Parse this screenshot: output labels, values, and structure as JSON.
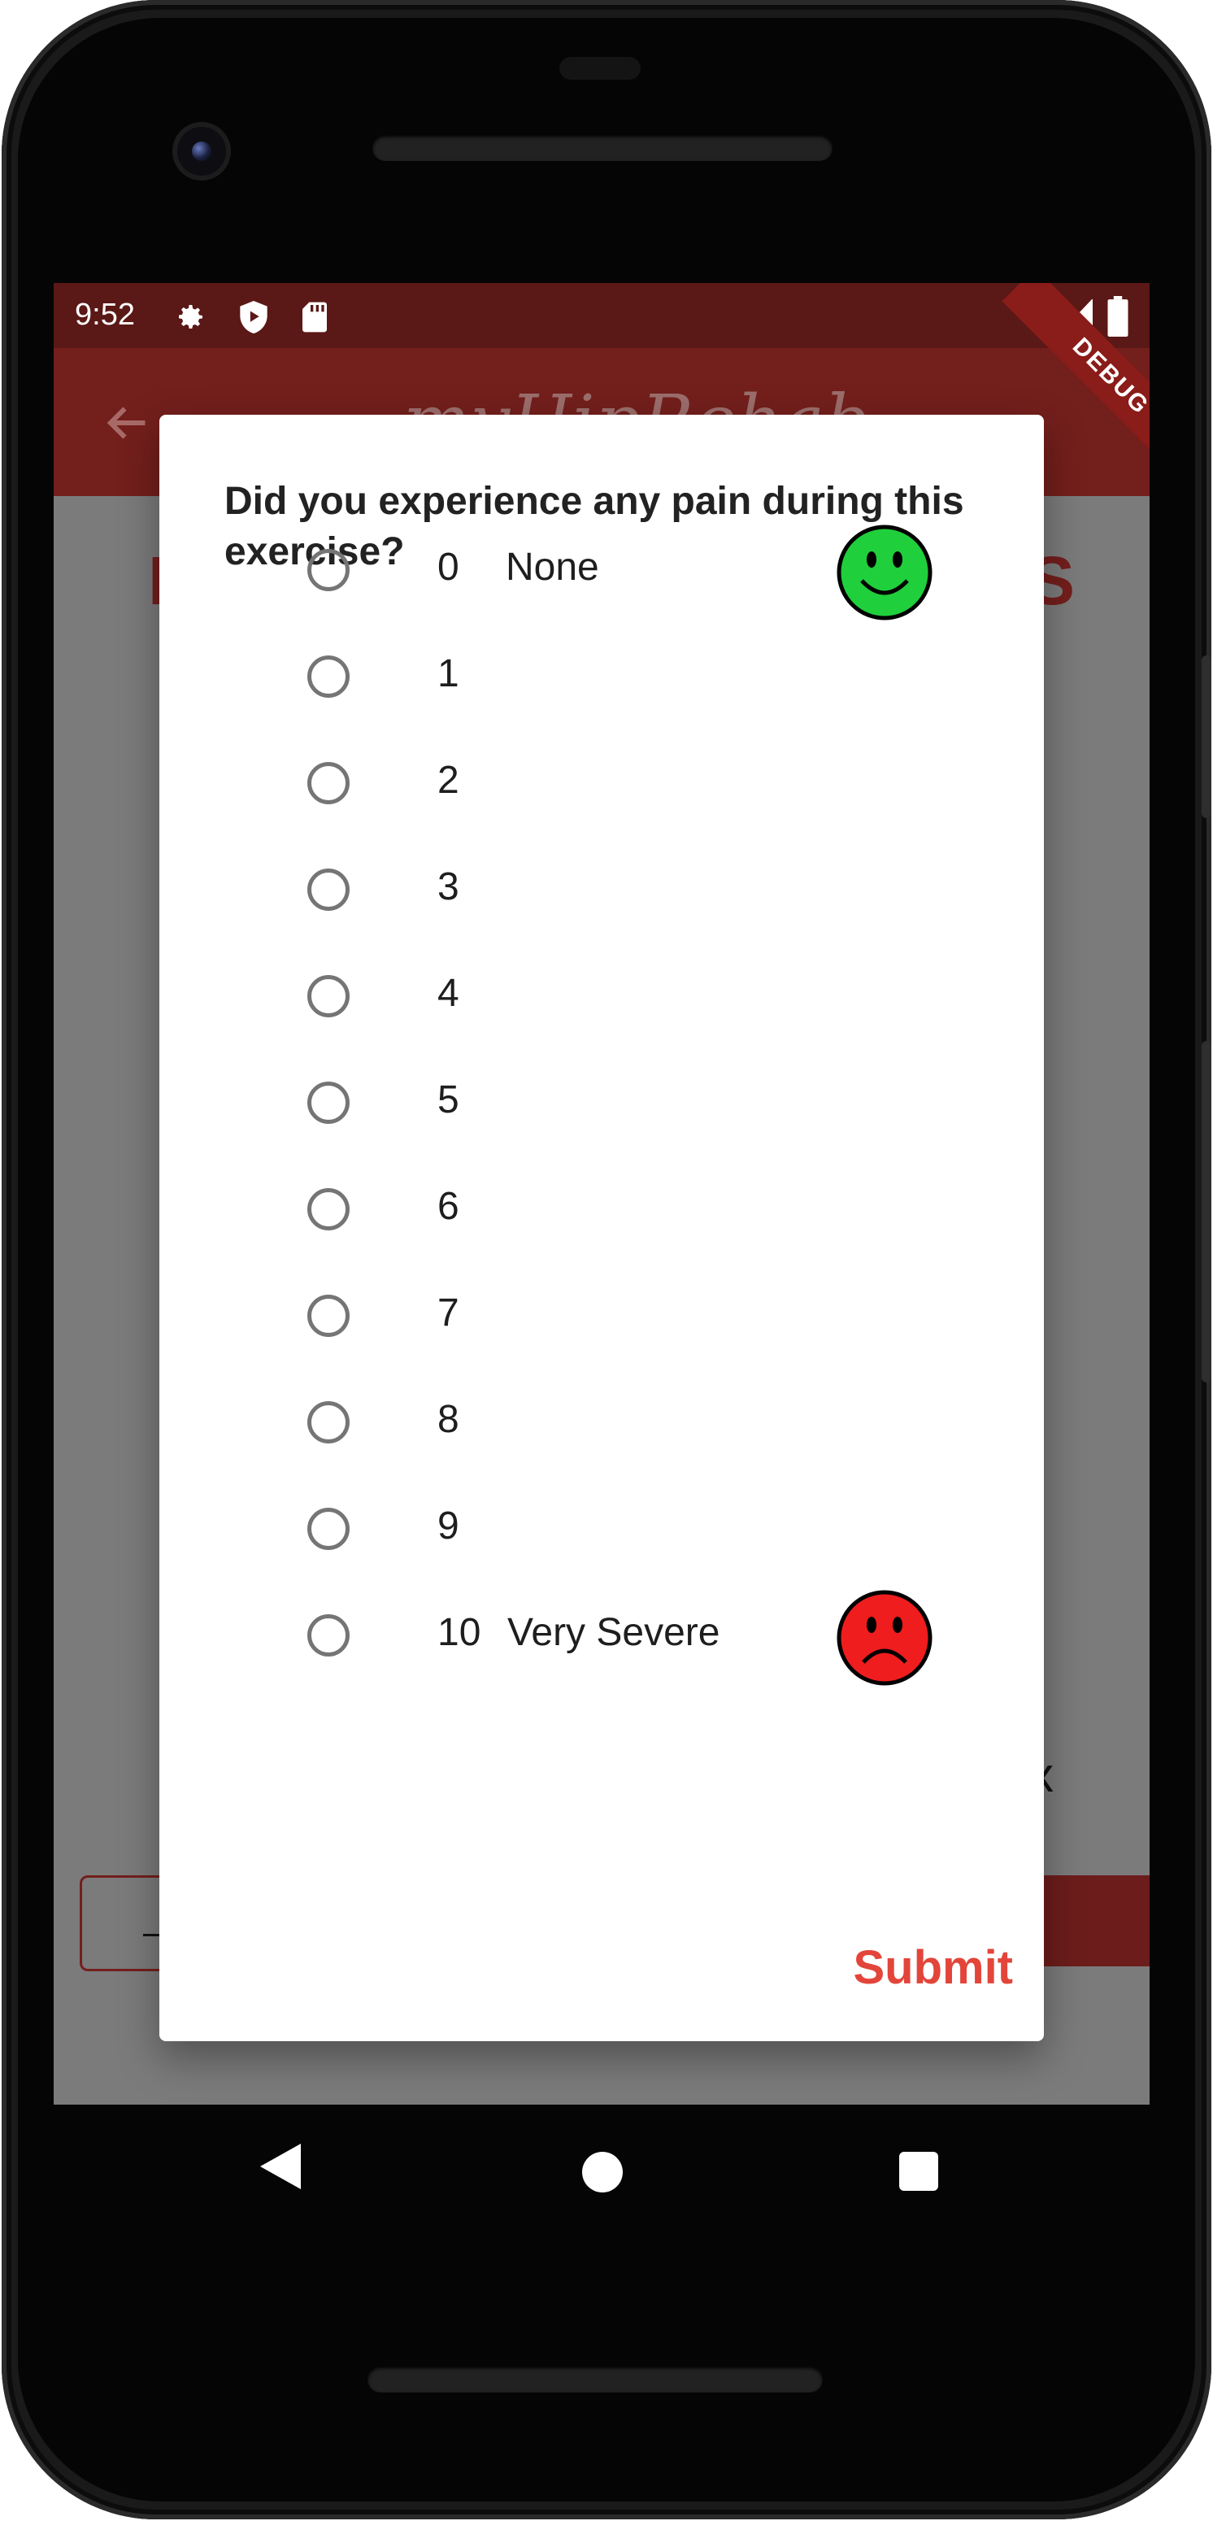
{
  "status_bar": {
    "time": "9:52",
    "left_icons": [
      "settings-gear-icon",
      "shield-play-icon",
      "sd-card-icon"
    ],
    "right_icons": [
      "wifi-icon",
      "signal-icon",
      "battery-icon"
    ],
    "debug_label": "DEBUG"
  },
  "app_bar": {
    "back_icon": "arrow-left-icon",
    "title": "myHipRehab"
  },
  "dialog": {
    "title": "Did you experience any pain during this exercise?",
    "options": [
      {
        "value": "0",
        "label": "None",
        "face": "happy-face-icon",
        "face_color": "#1fcf3b"
      },
      {
        "value": "1",
        "label": ""
      },
      {
        "value": "2",
        "label": ""
      },
      {
        "value": "3",
        "label": ""
      },
      {
        "value": "4",
        "label": ""
      },
      {
        "value": "5",
        "label": ""
      },
      {
        "value": "6",
        "label": ""
      },
      {
        "value": "7",
        "label": ""
      },
      {
        "value": "8",
        "label": ""
      },
      {
        "value": "9",
        "label": ""
      },
      {
        "value": "10",
        "label": "Very Severe",
        "face": "sad-face-icon",
        "face_color": "#ef1d1d"
      }
    ],
    "selected": null,
    "submit_label": "Submit"
  },
  "colors": {
    "app_bar": "#731f1c",
    "status_bar": "#5a1816",
    "accent_submit": "#e3453a",
    "radio_border": "#757575"
  },
  "nav_bar": {
    "items": [
      "back-triangle-icon",
      "home-circle-icon",
      "recents-square-icon"
    ]
  }
}
